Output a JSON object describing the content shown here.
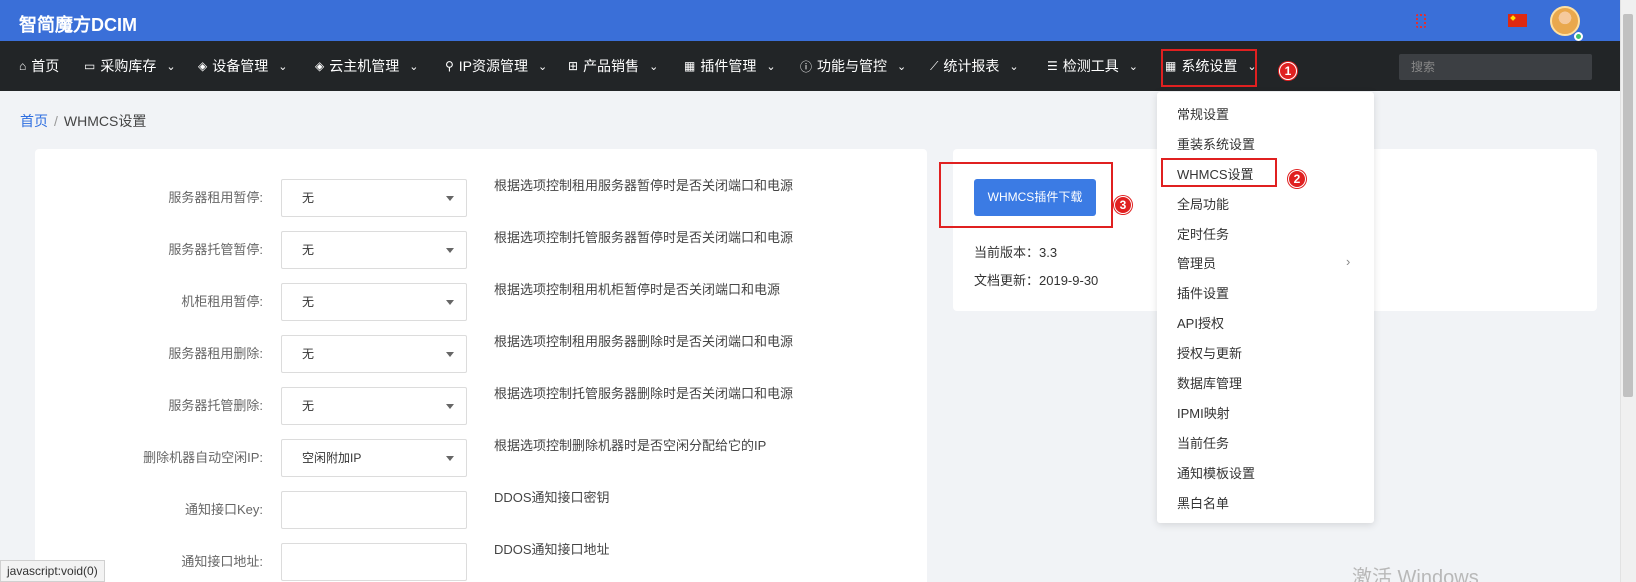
{
  "header": {
    "brand": "智简魔方DCIM",
    "avatar_icon": "user-avatar-icon",
    "status_color": "#3ec26a"
  },
  "nav": [
    {
      "label": "首页",
      "icon": "home-icon"
    },
    {
      "label": "采购库存",
      "icon": "inbox-icon"
    },
    {
      "label": "设备管理",
      "icon": "cube-icon"
    },
    {
      "label": "云主机管理",
      "icon": "cube-icon"
    },
    {
      "label": "IP资源管理",
      "icon": "map-marker-icon"
    },
    {
      "label": "产品销售",
      "icon": "cart-icon"
    },
    {
      "label": "插件管理",
      "icon": "grid-icon"
    },
    {
      "label": "功能与管控",
      "icon": "info-icon"
    },
    {
      "label": "统计报表",
      "icon": "line-chart-icon"
    },
    {
      "label": "检测工具",
      "icon": "list-icon"
    },
    {
      "label": "系统设置",
      "icon": "grid-icon"
    }
  ],
  "search": {
    "placeholder": "搜索"
  },
  "breadcrumb": {
    "home": "首页",
    "separator": "/",
    "current": "WHMCS设置"
  },
  "form": [
    {
      "label": "服务器租用暂停:",
      "type": "select",
      "value": "无",
      "help": "根据选项控制租用服务器暂停时是否关闭端口和电源"
    },
    {
      "label": "服务器托管暂停:",
      "type": "select",
      "value": "无",
      "help": "根据选项控制托管服务器暂停时是否关闭端口和电源"
    },
    {
      "label": "机柜租用暂停:",
      "type": "select",
      "value": "无",
      "help": "根据选项控制租用机柜暂停时是否关闭端口和电源"
    },
    {
      "label": "服务器租用删除:",
      "type": "select",
      "value": "无",
      "help": "根据选项控制租用服务器删除时是否关闭端口和电源"
    },
    {
      "label": "服务器托管删除:",
      "type": "select",
      "value": "无",
      "help": "根据选项控制托管服务器删除时是否关闭端口和电源"
    },
    {
      "label": "删除机器自动空闲IP:",
      "type": "select",
      "value": "空闲附加IP",
      "help": "根据选项控制删除机器时是否空闲分配给它的IP"
    },
    {
      "label": "通知接口Key:",
      "type": "input",
      "value": "",
      "help": "DDOS通知接口密钥"
    },
    {
      "label": "通知接口地址:",
      "type": "input",
      "value": "",
      "help": "DDOS通知接口地址"
    }
  ],
  "plugin": {
    "download_label": "WHMCS插件下载",
    "version_label": "当前版本：",
    "version": "3.3",
    "updated_label": "文档更新：",
    "updated": "2019-9-30"
  },
  "dropdown": [
    "常规设置",
    "重装系统设置",
    "WHMCS设置",
    "全局功能",
    "定时任务",
    "管理员",
    "插件设置",
    "API授权",
    "授权与更新",
    "数据库管理",
    "IPMI映射",
    "当前任务",
    "通知模板设置",
    "黑白名单"
  ],
  "callouts": [
    "1",
    "2",
    "3"
  ],
  "status_bar": "javascript:void(0)",
  "watermark": "激活 Windows",
  "colors": {
    "topbar": "#3a6fd8",
    "navbar": "#222527",
    "accent": "#3b7be4",
    "highlight": "#e02020"
  }
}
